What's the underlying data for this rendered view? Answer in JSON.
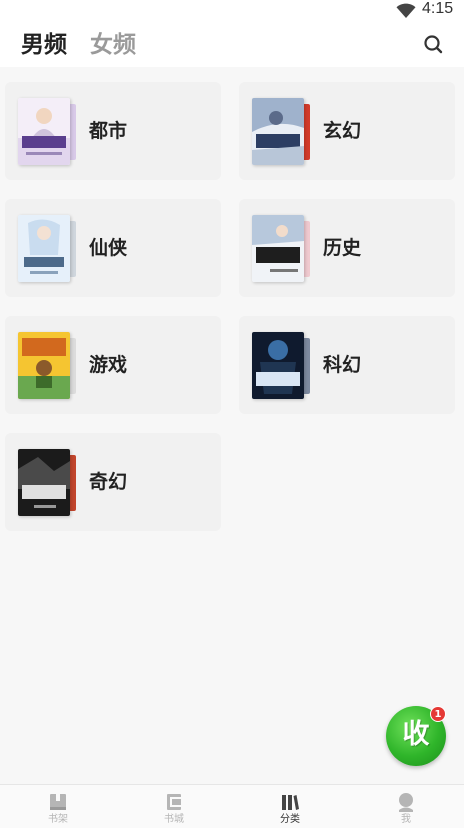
{
  "status_bar": {
    "time": "4:15",
    "wifi_icon": "wifi-icon"
  },
  "header": {
    "tabs": [
      {
        "label": "男频",
        "active": true
      },
      {
        "label": "女频",
        "active": false
      }
    ],
    "search_icon": "search-icon"
  },
  "categories": [
    {
      "label": "都市"
    },
    {
      "label": "玄幻"
    },
    {
      "label": "仙侠"
    },
    {
      "label": "历史"
    },
    {
      "label": "游戏"
    },
    {
      "label": "科幻"
    },
    {
      "label": "奇幻"
    }
  ],
  "fab": {
    "label": "收",
    "badge": "1",
    "color": "#2fb52a",
    "badge_color": "#e53935"
  },
  "bottom_nav": {
    "items": [
      {
        "label": "书架",
        "icon": "bookshelf-icon",
        "active": false
      },
      {
        "label": "书城",
        "icon": "bookstore-icon",
        "active": false
      },
      {
        "label": "分类",
        "icon": "category-icon",
        "active": true
      },
      {
        "label": "我",
        "icon": "profile-icon",
        "active": false
      }
    ]
  }
}
